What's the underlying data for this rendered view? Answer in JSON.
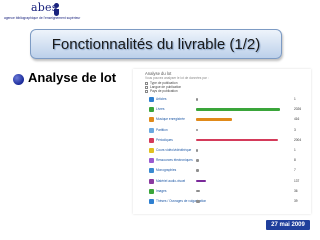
{
  "logo": {
    "word": "abes",
    "subtitle": "agence bibliographique de l'enseignement supérieur",
    "icon": "abes-logo-icon"
  },
  "slide": {
    "title": "Fonctionnalités du livrable (1/2)",
    "bullet": "Analyse de lot",
    "date": "27 mai 2009"
  },
  "panel": {
    "title": "Analyse du lot",
    "description": "Vous pouvez analyser le lot de données par :",
    "filters": [
      {
        "label": "Type de publication"
      },
      {
        "label": "Langue de publication"
      },
      {
        "label": "Pays de publication"
      }
    ],
    "rows": [
      {
        "label": "Articles",
        "count": "1",
        "bar_fraction": 0.02,
        "color": "#8e8e8e"
      },
      {
        "label": "Livres",
        "count": "2026",
        "bar_fraction": 0.88,
        "color": "#3aa53a"
      },
      {
        "label": "Musique enregistrée",
        "count": "416",
        "bar_fraction": 0.38,
        "color": "#e08a1a"
      },
      {
        "label": "Partition",
        "count": "3",
        "bar_fraction": 0.02,
        "color": "#8e8e8e"
      },
      {
        "label": "Périodiques",
        "count": "2004",
        "bar_fraction": 0.86,
        "color": "#d43a5a"
      },
      {
        "label": "Cours vidéo/vidéothèque",
        "count": "1",
        "bar_fraction": 0.02,
        "color": "#8e8e8e"
      },
      {
        "label": "Ressources électroniques",
        "count": "8",
        "bar_fraction": 0.03,
        "color": "#8e8e8e"
      },
      {
        "label": "Monographies",
        "count": "7",
        "bar_fraction": 0.03,
        "color": "#8e8e8e"
      },
      {
        "label": "Matériel audio-visuel",
        "count": "137",
        "bar_fraction": 0.1,
        "color": "#7a2a9a"
      },
      {
        "label": "Images",
        "count": "36",
        "bar_fraction": 0.04,
        "color": "#8e8e8e"
      },
      {
        "label": "Thèses / Ouvrages de vulgarisation",
        "count": "39",
        "bar_fraction": 0.04,
        "color": "#8e8e8e"
      }
    ],
    "row_icon_colors": [
      "#2e7fd0",
      "#3aa53a",
      "#e08a1a",
      "#6aa8e0",
      "#d43a5a",
      "#e0c020",
      "#9a5ad0",
      "#3a8ad0",
      "#8a3aa0",
      "#3aa53a",
      "#2e7fd0"
    ]
  }
}
